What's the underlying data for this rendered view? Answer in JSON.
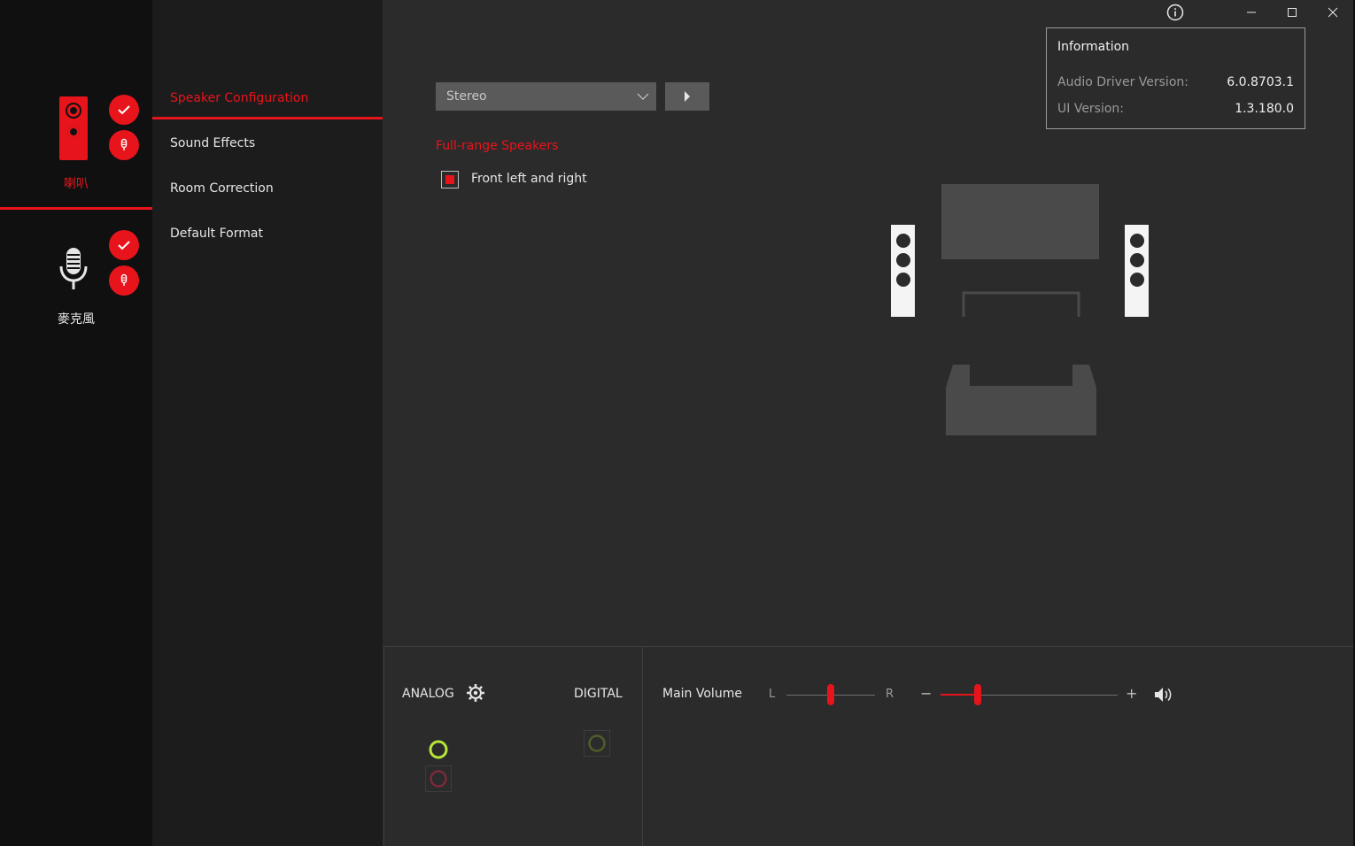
{
  "devices": {
    "speaker": {
      "label": "喇叭",
      "color": "#e8141c"
    },
    "microphone": {
      "label": "麥克風",
      "color": "#e6e6e6"
    }
  },
  "nav": {
    "items": [
      {
        "label": "Speaker Configuration",
        "active": true
      },
      {
        "label": "Sound Effects",
        "active": false
      },
      {
        "label": "Room Correction",
        "active": false
      },
      {
        "label": "Default Format",
        "active": false
      }
    ]
  },
  "config": {
    "dropdown_value": "Stereo",
    "section_title": "Full-range Speakers",
    "checkbox_label": "Front left and right",
    "checkbox_checked": true
  },
  "info": {
    "title": "Information",
    "rows": [
      {
        "key": "Audio Driver Version:",
        "value": "6.0.8703.1"
      },
      {
        "key": "UI Version:",
        "value": "1.3.180.0"
      }
    ]
  },
  "bottom": {
    "analog_label": "ANALOG",
    "digital_label": "DIGITAL",
    "main_volume_label": "Main Volume",
    "balance_left": "L",
    "balance_right": "R",
    "volume_minus": "−",
    "volume_plus": "+",
    "balance_value": 0.5,
    "volume_value": 0.21
  },
  "colors": {
    "accent": "#e8141c",
    "jack_green": "#b7e63a",
    "jack_pink": "#7a2a3a",
    "jack_digital": "#4e5e2a"
  }
}
